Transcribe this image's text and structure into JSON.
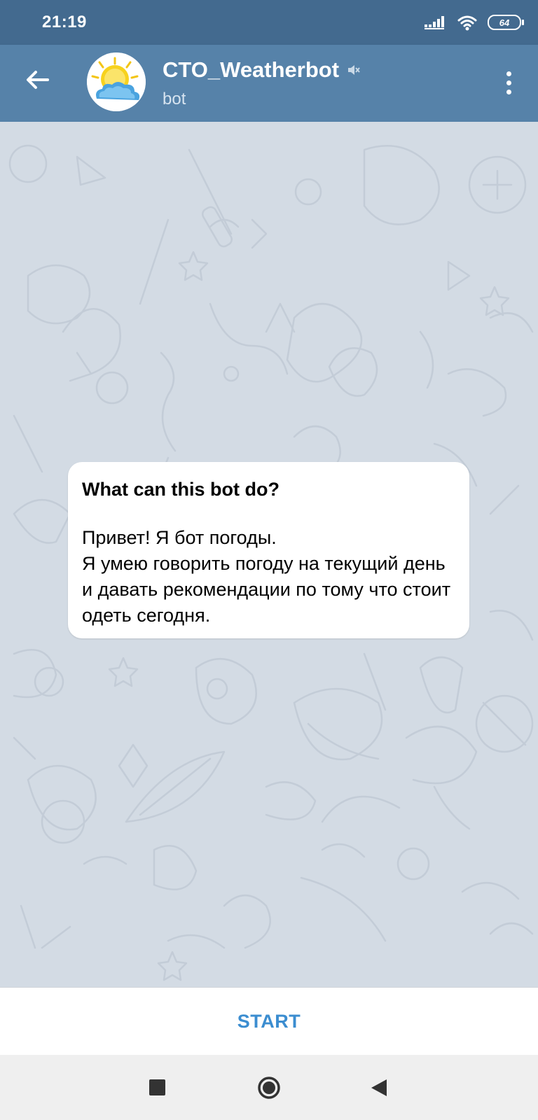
{
  "status_bar": {
    "time": "21:19",
    "battery_level": "64",
    "icons": [
      "signal-icon",
      "wifi-icon",
      "battery-icon"
    ]
  },
  "header": {
    "title": "CTO_Weatherbot",
    "subtitle": "bot",
    "avatar_icon": "sun-cloud-avatar",
    "muted_icon": "muted-speaker-icon",
    "back_icon": "back-arrow-icon",
    "menu_icon": "more-vertical-icon"
  },
  "bot_info": {
    "title": "What can this bot do?",
    "body": "Привет! Я бот погоды.\nЯ умею говорить погоду на текущий день и давать рекомендации по тому что стоит одеть сегодня."
  },
  "start_bar": {
    "button_label": "START"
  },
  "nav_bar": {
    "icons": [
      "recents-icon",
      "home-icon",
      "back-icon"
    ]
  },
  "colors": {
    "status_bar": "#436a8f",
    "header": "#5682a9",
    "chat_background": "#d3dbe4",
    "accent": "#3b8dd0"
  }
}
